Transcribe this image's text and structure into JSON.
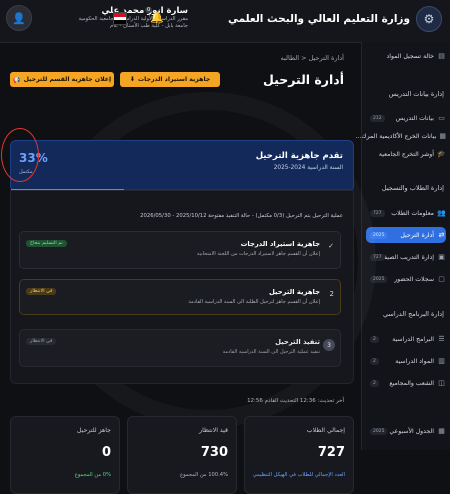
{
  "header": {
    "ministry_title": "وزارة التعليم العالي والبحث العلمي",
    "user_name": "سارة انور محمد علي",
    "user_role_line1": "مقرر الدراسات الأولية الدراسات الجامعية الحكومية",
    "user_role_line2": "جامعة بابل - كلية طب الأسنان - عام",
    "notification_count": "0",
    "flag_colors": [
      "#ce1126",
      "#ffffff",
      "#000000"
    ]
  },
  "sidebar": {
    "top_item": "خالة تسجيل المواد",
    "section1": "إدارة بيانات التدريس",
    "s1_items": [
      {
        "label": "بيانات التدريس",
        "badge": "212"
      },
      {
        "label": "بيانات الخرج الأكاديمية المرك...",
        "badge": ""
      },
      {
        "label": "أوشر التخرج الجامعية",
        "badge": ""
      }
    ],
    "section2": "إدارة الطلاب والتسجيل",
    "s2_items": [
      {
        "label": "معلومات الطلاب",
        "badge": "727"
      },
      {
        "label": "أدارة الترحيل",
        "badge": "2025",
        "active": true
      },
      {
        "label": "إدارة التدريب الصيفي",
        "badge": "727"
      },
      {
        "label": "سجلات الحضور",
        "badge": "2025"
      }
    ],
    "section3": "إدارة البرنامج الدراسي",
    "s3_items": [
      {
        "label": "البرامج الدراسية",
        "badge": "2"
      },
      {
        "label": "المواد الدراسية",
        "badge": "2"
      },
      {
        "label": "الشعب والمجاميع",
        "badge": "2"
      },
      {
        "label": "الجدول الأسبوعي",
        "badge": "2025"
      }
    ]
  },
  "main": {
    "breadcrumb": "أدارة الترحيل  <  الطالبه",
    "title": "أدارة الترحيل",
    "btn_export": "إعلان جاهزية القسم للترحيل",
    "btn_import": "جاهزية استيراد الدرجات",
    "progress": {
      "title": "تقدم جاهزية الترحيل",
      "subtitle": "السنة الدراسية 2024-2025",
      "percent": "33%",
      "percent_value": 0.33,
      "percent_label": "مكتمل"
    },
    "timeline_info": "عملية الترحيل بتم الترحيل (0/3 مكتمل) - حالة التنفيذ مفتوحة 2025/10/12 - 2026/05/30",
    "steps": [
      {
        "mark": "✓",
        "title": "جاهزية استيراد الدرجات",
        "desc": "إعلان أن القسم جاهز لاستيراد الدرجات من اللجنة الامتحانية",
        "badge": "تم التسليم بنجاح"
      },
      {
        "mark": "2",
        "title": "جاهزية الترحيل",
        "desc": "إعلان أن القسم جاهز لترحيل الطلبة الى السنة الدراسية القادمة",
        "badge": "في الانتظار"
      },
      {
        "mark": "3",
        "title": "تنفيذ الترحيل",
        "desc": "تنفيذ عملية الترحيل الى السنة الدراسية القادمة",
        "badge": "في الانتظار"
      }
    ],
    "last_update": "أخر تحديث: 12:36 التحديث القادم 12:56",
    "stats": [
      {
        "label": "إجمالي الطلاب",
        "value": "727",
        "sub": "العدد الإجمالي للطلاب في الهيكل التنظيمي",
        "sub_color": "#6da1ff"
      },
      {
        "label": "قيد الانتظار",
        "value": "730",
        "sub": "100.4% من المجموع",
        "sub_color": "#aeb3bd"
      },
      {
        "label": "جاهز للترحيل",
        "value": "0",
        "sub": "0% من المجموع",
        "sub_color": "#4ade80"
      }
    ]
  }
}
